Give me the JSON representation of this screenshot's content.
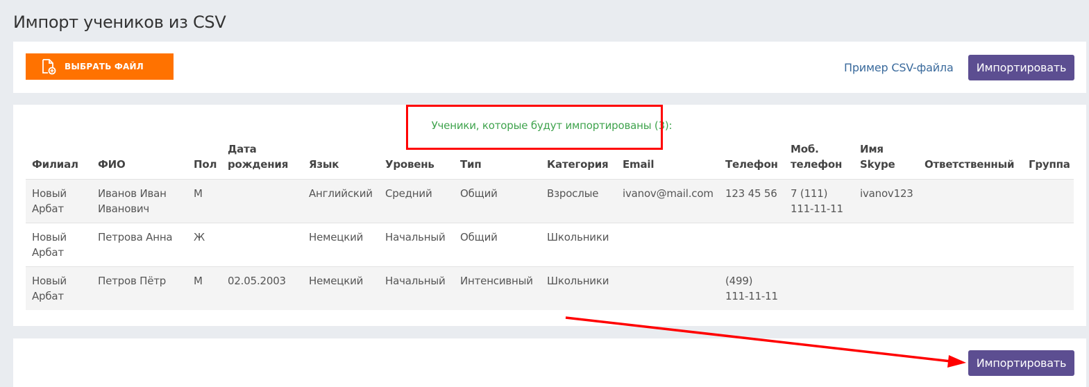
{
  "page": {
    "title": "Импорт учеников из CSV"
  },
  "toolbar": {
    "choose_file_label": "ВЫБРАТЬ ФАЙЛ",
    "sample_link_label": "Пример CSV-файла",
    "import_label": "Импортировать"
  },
  "preview": {
    "caption": "Ученики, которые будут импортированы (3):",
    "columns": [
      "Филиал",
      "ФИО",
      "Пол",
      "Дата рождения",
      "Язык",
      "Уровень",
      "Тип",
      "Категория",
      "Email",
      "Телефон",
      "Моб. телефон",
      "Имя Skype",
      "Ответственный",
      "Группа"
    ],
    "rows": [
      [
        "Новый Арбат",
        "Иванов Иван Иванович",
        "М",
        "",
        "Английский",
        "Средний",
        "Общий",
        "Взрослые",
        "ivanov@mail.com",
        "123 45 56",
        "7 (111) 111-11-11",
        "ivanov123",
        "",
        ""
      ],
      [
        "Новый Арбат",
        "Петрова Анна",
        "Ж",
        "",
        "Немецкий",
        "Начальный",
        "Общий",
        "Школьники",
        "",
        "",
        "",
        "",
        "",
        ""
      ],
      [
        "Новый Арбат",
        "Петров Пётр",
        "М",
        "02.05.2003",
        "Немецкий",
        "Начальный",
        "Интенсивный",
        "Школьники",
        "",
        "(499) 111-11-11",
        "",
        "",
        "",
        ""
      ]
    ]
  },
  "bottom": {
    "import_label": "Импортировать"
  },
  "colors": {
    "accent_orange": "#ff7200",
    "primary_purple": "#5c4e91",
    "success_green": "#3fa34d",
    "annotation_red": "#ff0000",
    "link_blue": "#3a6a9c"
  }
}
